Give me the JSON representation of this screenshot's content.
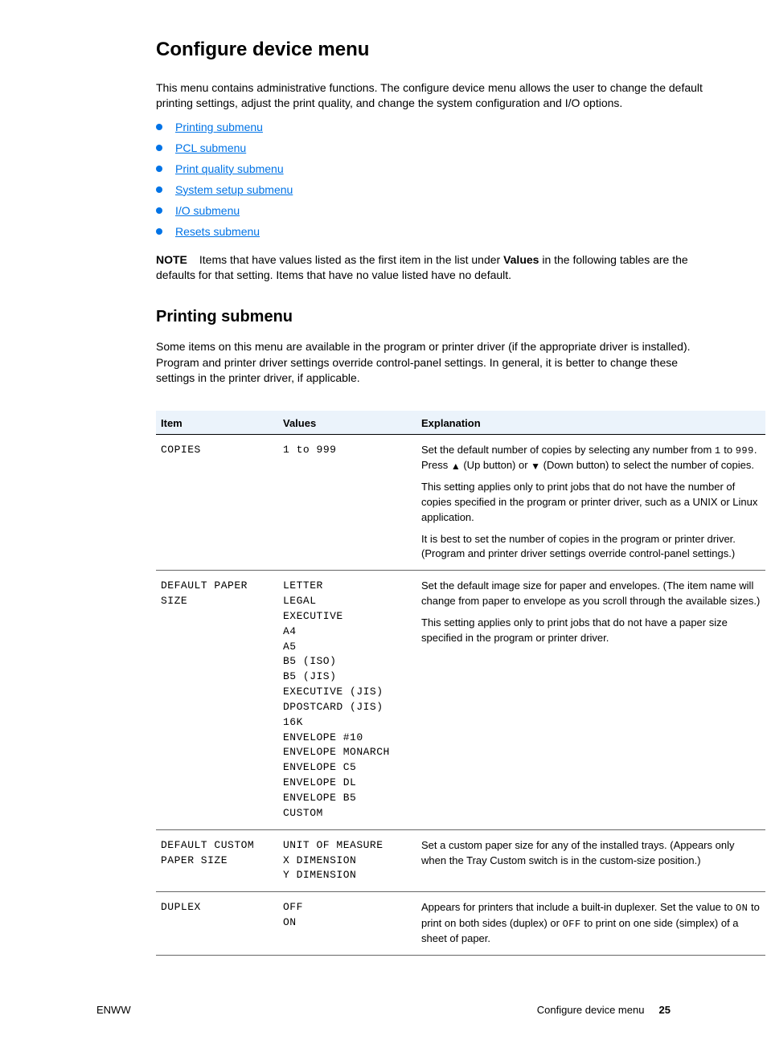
{
  "heading": "Configure device menu",
  "intro": "This menu contains administrative functions. The configure device menu allows the user to change the default printing settings, adjust the print quality, and change the system configuration and I/O options.",
  "links": [
    "Printing submenu",
    "PCL submenu",
    "Print quality submenu",
    "System setup submenu",
    "I/O submenu",
    "Resets submenu"
  ],
  "note": {
    "label": "NOTE",
    "lead": "Items that have values listed as the first item in the list under ",
    "values_word": "Values",
    "after_values": " in the following tables are the defaults for that setting. Items that have no value listed have no default."
  },
  "submenu_heading": "Printing submenu",
  "submenu_desc": "Some items on this menu are available in the program or printer driver (if the appropriate driver is installed). Program and printer driver settings override control-panel settings. In general, it is better to change these settings in the printer driver, if applicable.",
  "columns": {
    "item": "Item",
    "values": "Values",
    "explanation": "Explanation"
  },
  "rows": {
    "copies": {
      "item": "COPIES",
      "values_range": [
        "1",
        "999"
      ],
      "range_sep": " to ",
      "exp_lead": "Set the default number of copies by selecting any number from ",
      "exp_mid": " to ",
      "exp_after": ". Press ",
      "exp_after2": " (Up button) or ",
      "exp_after3": " (Down button) to select the number of copies.",
      "exp_p2": "This setting applies only to print jobs that do not have the number of copies specified in the program or printer driver, such as a UNIX or Linux application.",
      "exp_p3_lead": "It is best to set the number of copies in the program or printer driver. (Program and printer driver settings override control-panel settings.)"
    },
    "paper_size": {
      "item_l1": "DEFAULT PAPER",
      "item_l2": "SIZE",
      "values": [
        "LETTER",
        "LEGAL",
        "EXECUTIVE",
        "A4",
        "A5",
        "B5 (ISO)",
        "B5 (JIS)",
        "EXECUTIVE (JIS)",
        "DPOSTCARD (JIS)",
        "16K",
        "ENVELOPE #10",
        "ENVELOPE MONARCH",
        "ENVELOPE C5",
        "ENVELOPE DL",
        "ENVELOPE B5",
        "CUSTOM"
      ],
      "exp_p1": "Set the default image size for paper and envelopes. (The item name will change from paper to envelope as you scroll through the available sizes.)",
      "exp_p2": "This setting applies only to print jobs that do not have a paper size specified in the program or printer driver."
    },
    "custom_paper": {
      "item_l1": "DEFAULT CUSTOM",
      "item_l2": "PAPER SIZE",
      "values": [
        "UNIT OF MEASURE",
        "X DIMENSION",
        "Y DIMENSION"
      ],
      "exp": "Set a custom paper size for any of the installed trays. (Appears only when the Tray Custom switch is in the custom-size position.)"
    },
    "duplex": {
      "item": "DUPLEX",
      "values": [
        "OFF",
        "ON"
      ],
      "exp_lead": "Appears for printers that include a built-in duplexer. Set the value to ",
      "on_word": "ON",
      "exp_mid": " to print on both sides (duplex) or ",
      "off_word": "OFF",
      "exp_after": " to print on one side (simplex) of a sheet of paper."
    }
  },
  "footer": {
    "left": "ENWW",
    "right_text": "Configure device menu",
    "right_page": "25"
  }
}
